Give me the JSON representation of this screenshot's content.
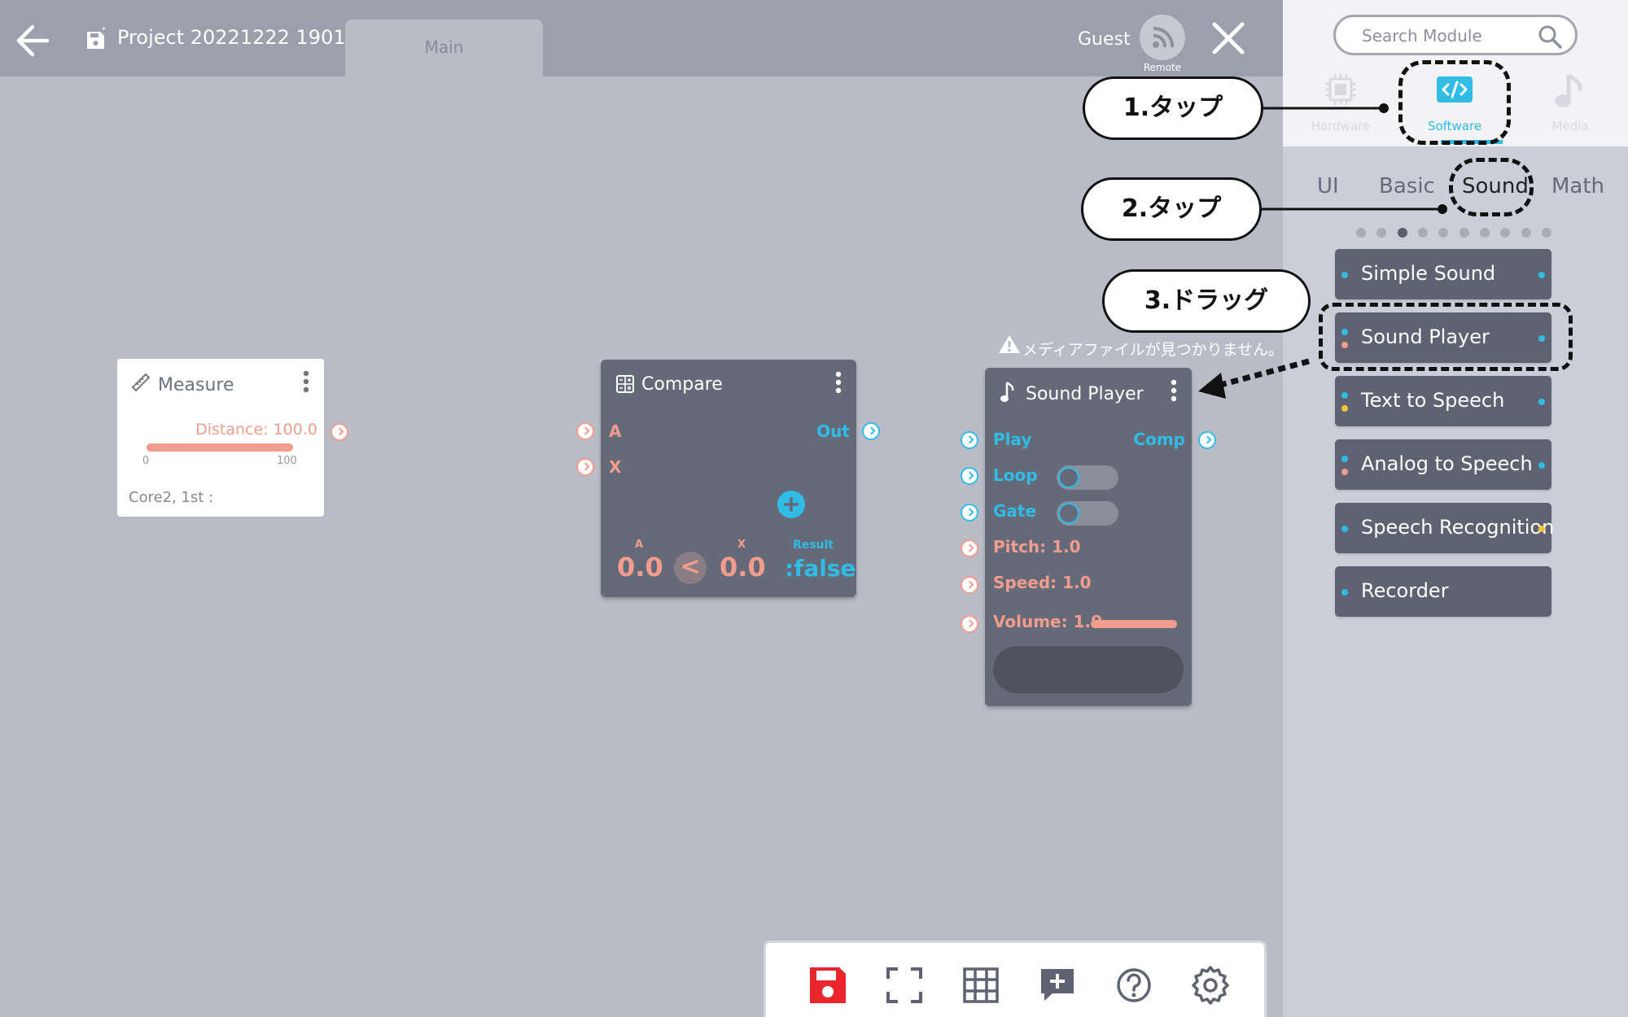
{
  "header": {
    "project_title": "Project 20221222 1901",
    "main_tab_label": "Main",
    "user_label": "Guest",
    "remote_label": "Remote"
  },
  "sidebar": {
    "search": {
      "placeholder": "Search Module"
    },
    "categories": [
      {
        "label": "Hardware",
        "icon": "chip-icon",
        "active": false
      },
      {
        "label": "Software",
        "icon": "code-icon",
        "active": true
      },
      {
        "label": "Media",
        "icon": "music-note-icon",
        "active": false
      }
    ],
    "subtabs": [
      "UI",
      "Basic",
      "Sound",
      "Math"
    ],
    "active_subtab": "Sound",
    "page_count": 10,
    "active_page": 3,
    "modules": [
      {
        "label": "Simple Sound"
      },
      {
        "label": "Sound Player"
      },
      {
        "label": "Text to Speech"
      },
      {
        "label": "Analog to Speech"
      },
      {
        "label": "Speech Recognition"
      },
      {
        "label": "Recorder"
      }
    ]
  },
  "nodes": {
    "measure": {
      "title": "Measure",
      "distance_label": "Distance: 100.0",
      "range_min": "0",
      "range_max": "100",
      "progress": 1.0,
      "footer": "Core2, 1st :"
    },
    "compare": {
      "title": "Compare",
      "input_a": "A",
      "input_x": "X",
      "output": "Out",
      "label_a": "A",
      "label_x": "X",
      "label_result": "Result",
      "value_a": "0.0",
      "operator": "<",
      "value_x": "0.0",
      "result": ":false"
    },
    "sound_player": {
      "warning": "メディアファイルが見つかりません。",
      "title": "Sound Player",
      "play": "Play",
      "comp": "Comp",
      "loop": "Loop",
      "gate": "Gate",
      "pitch": "Pitch: 1.0",
      "speed": "Speed: 1.0",
      "volume": "Volume: 1.0",
      "volume_level": 1.0
    }
  },
  "annotations": {
    "step1": "1.タップ",
    "step2": "2.タップ",
    "step3": "3.ドラッグ"
  },
  "colors": {
    "accent_blue": "#31bce5",
    "accent_orange": "#f19c8d",
    "save_red": "#e8262c",
    "node_bg": "#656a78"
  }
}
